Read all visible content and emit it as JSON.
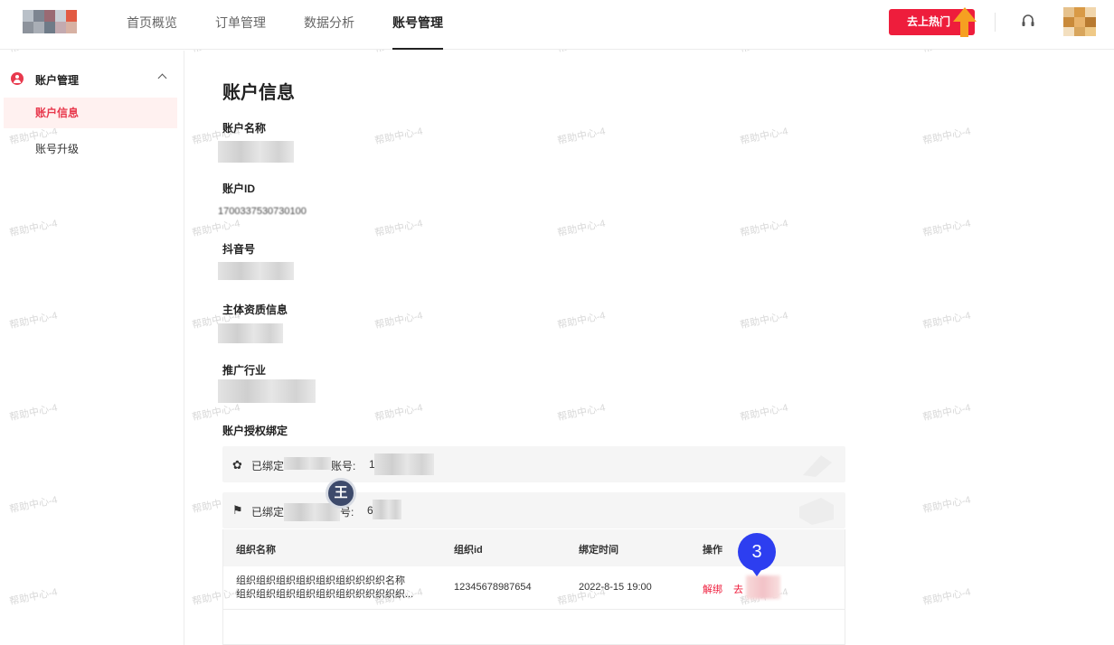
{
  "header": {
    "nav": [
      "首页概览",
      "订单管理",
      "数据分析",
      "账号管理"
    ],
    "active_nav": "账号管理",
    "hot_button": "去上热门",
    "logo_colors": [
      "#b9c0c8",
      "#7d8591",
      "#9a6a73",
      "#c9cfd6",
      "#e25b43",
      "#8d939c",
      "#a9aeb6",
      "#6f7b88",
      "#c3aab0",
      "#d7b1a3"
    ],
    "avatar_colors": [
      "#e6c28d",
      "#d99a46",
      "#f1d6ac",
      "#c98a3a",
      "#e8b26a",
      "#b87a30",
      "#f3dfbf",
      "#d8a55c",
      "#efc987"
    ]
  },
  "sidebar": {
    "group": "账户管理",
    "items": [
      {
        "label": "账户信息",
        "active": true
      },
      {
        "label": "账号升级",
        "active": false
      }
    ]
  },
  "main": {
    "title": "账户信息",
    "fields": [
      {
        "label": "账户名称"
      },
      {
        "label": "账户ID",
        "value": "1700337530730100"
      },
      {
        "label": "抖音号"
      },
      {
        "label": "主体资质信息"
      },
      {
        "label": "推广行业"
      }
    ],
    "binding_title": "账户授权绑定",
    "bind_rows": [
      {
        "icon": "✿",
        "prefix": "已绑定",
        "suffix": "账号:",
        "tail": "1"
      },
      {
        "icon": "⚑",
        "prefix": "已绑定",
        "suffix": "号:",
        "tail": "6"
      }
    ],
    "table": {
      "headers": [
        "组织名称",
        "组织id",
        "绑定时间",
        "操作"
      ],
      "rows": [
        {
          "name_line1": "组织组织组织组织组织组织织织织名称",
          "name_line2": "组织组织组织组织组织组织织织织织织...",
          "id": "12345678987654",
          "time": "2022-8-15 19:00",
          "action_unbind": "解绑",
          "action_go": "去"
        }
      ]
    }
  },
  "overlays": {
    "badge_wang": "王",
    "badge_three": "3"
  },
  "watermark": "帮助中心-4"
}
